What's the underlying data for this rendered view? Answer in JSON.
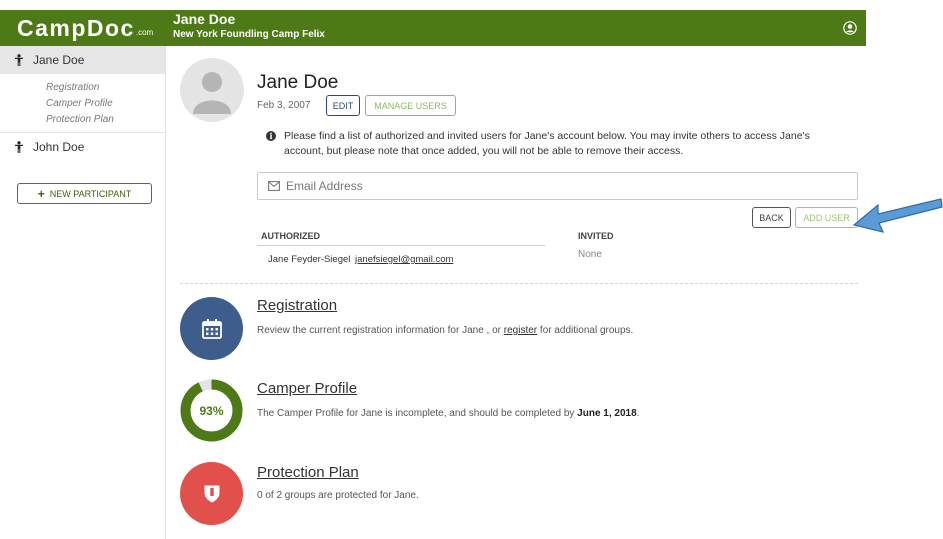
{
  "header": {
    "logo_main": "CampDoc",
    "logo_domain": ".com",
    "participant_name": "Jane Doe",
    "camp_name": "New York Foundling Camp Felix",
    "user_icon": "user-circle-icon"
  },
  "sidebar": {
    "participants": [
      {
        "name": "Jane Doe",
        "active": true,
        "icon": "person-icon",
        "subitems": [
          "Registration",
          "Camper Profile",
          "Protection Plan"
        ]
      },
      {
        "name": "John Doe",
        "active": false,
        "icon": "person-icon"
      }
    ],
    "new_participant_label": "NEW PARTICIPANT"
  },
  "profile": {
    "name": "Jane Doe",
    "dob": "Feb 3, 2007",
    "edit_label": "EDIT",
    "manage_users_label": "MANAGE USERS"
  },
  "manage_users": {
    "info_text": "Please find a list of authorized and invited users for Jane's account below. You may invite others to access Jane's account, but please note that once added, you will not be able to remove their access.",
    "email_placeholder": "Email Address",
    "back_label": "BACK",
    "add_user_label": "ADD USER",
    "authorized_header": "AUTHORIZED",
    "invited_header": "INVITED",
    "authorized_users": [
      {
        "name": "Jane Feyder-Siegel",
        "email": "janefsiegel@gmail.com"
      }
    ],
    "invited_value": "None"
  },
  "sections": {
    "registration": {
      "title": "Registration",
      "desc_before": "Review the current registration information for Jane , or ",
      "desc_link": "register",
      "desc_after": " for additional groups.",
      "icon": "calendar-icon",
      "color": "#3e5d8c"
    },
    "camper_profile": {
      "title": "Camper Profile",
      "percent": 93,
      "percent_label": "93%",
      "desc_before": "The Camper Profile for Jane is incomplete, and should be completed by ",
      "desc_bold": "June 1, 2018",
      "desc_after": ".",
      "color": "#4d7a16"
    },
    "protection_plan": {
      "title": "Protection Plan",
      "desc": "0 of 2 groups are protected for Jane.",
      "icon": "shield-icon",
      "color": "#e2504b"
    }
  },
  "annotation": {
    "arrow_color": "#5b9bd5"
  }
}
